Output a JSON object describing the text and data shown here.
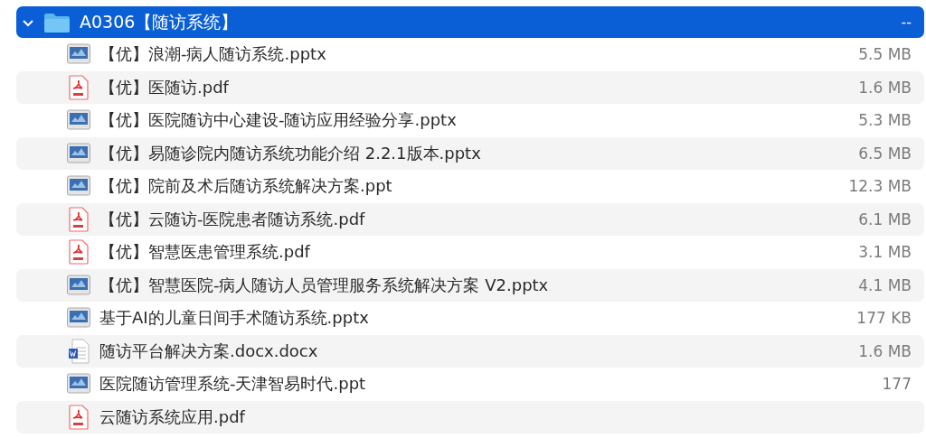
{
  "folder": {
    "name": "A0306【随访系统】",
    "size": "--",
    "expanded": true,
    "selected": true,
    "files": [
      {
        "kind": "slide",
        "name": "【优】浪潮-病人随访系统.pptx",
        "size": "5.5 MB"
      },
      {
        "kind": "pdf",
        "name": "【优】医随访.pdf",
        "size": "1.6 MB"
      },
      {
        "kind": "slide",
        "name": "【优】医院随访中心建设-随访应用经验分享.pptx",
        "size": "5.3 MB"
      },
      {
        "kind": "slide",
        "name": "【优】易随诊院内随访系统功能介绍 2.2.1版本.pptx",
        "size": "6.5 MB"
      },
      {
        "kind": "slide",
        "name": "【优】院前及术后随访系统解决方案.ppt",
        "size": "12.3 MB"
      },
      {
        "kind": "pdf",
        "name": "【优】云随访-医院患者随访系统.pdf",
        "size": "6.1 MB"
      },
      {
        "kind": "pdf",
        "name": "【优】智慧医患管理系统.pdf",
        "size": "3.1 MB"
      },
      {
        "kind": "slide",
        "name": "【优】智慧医院-病人随访人员管理服务系统解决方案 V2.pptx",
        "size": "4.1 MB"
      },
      {
        "kind": "slide",
        "name": "基于AI的儿童日间手术随访系统.pptx",
        "size": "177 KB"
      },
      {
        "kind": "word",
        "name": "随访平台解决方案.docx.docx",
        "size": "1.6 MB"
      },
      {
        "kind": "slide",
        "name": "医院随访管理系统-天津智易时代.ppt",
        "size": "177"
      },
      {
        "kind": "pdf",
        "name": "云随访系统应用.pdf"
      }
    ]
  }
}
